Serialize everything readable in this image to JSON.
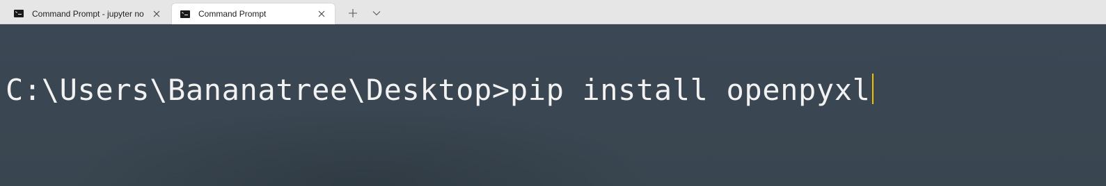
{
  "tabs": [
    {
      "title": "Command Prompt - jupyter  no",
      "icon": "command-prompt-icon",
      "active": false
    },
    {
      "title": "Command Prompt",
      "icon": "command-prompt-icon",
      "active": true
    }
  ],
  "controls": {
    "new_tab_icon": "plus-icon",
    "dropdown_icon": "chevron-down-icon",
    "close_icon": "close-icon"
  },
  "terminal": {
    "prompt": "C:\\Users\\Bananatree\\Desktop>",
    "command": "pip install openpyxl",
    "cursor_color": "#f2c200",
    "background_color": "#3a4652",
    "text_color": "#f2f2f2"
  }
}
